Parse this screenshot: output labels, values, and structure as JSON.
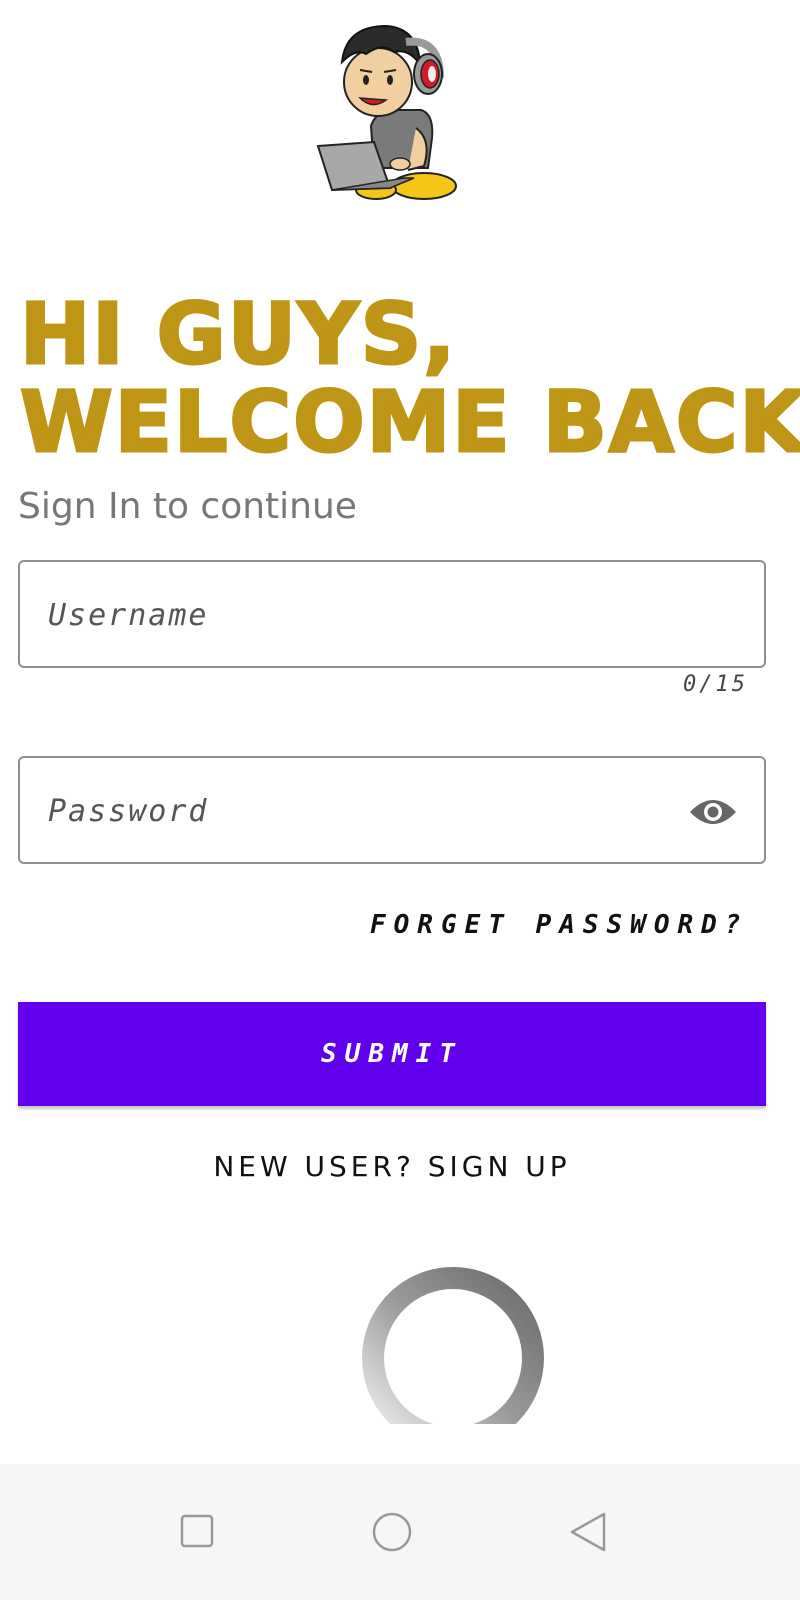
{
  "header": {
    "title_line1": "HI GUYS,",
    "title_line2": "WELCOME BACK",
    "subtitle": "Sign In to continue"
  },
  "logo": {
    "icon": "gamer-boy-laptop-illustration"
  },
  "form": {
    "username": {
      "value": "",
      "placeholder": "Username",
      "counter": "0/15"
    },
    "password": {
      "value": "",
      "placeholder": "Password",
      "toggle_icon": "eye-icon"
    },
    "forget_label": "FORGET PASSWORD?",
    "submit_label": "SUBMIT",
    "signup_label": "NEW USER? SIGN UP"
  },
  "loading": {
    "icon": "loading-spinner"
  },
  "navbar": {
    "items": [
      {
        "icon": "square-icon"
      },
      {
        "icon": "circle-icon"
      },
      {
        "icon": "triangle-back-icon"
      }
    ]
  },
  "colors": {
    "title": "#bf9515",
    "accent": "#6200ee",
    "subtitle": "#777777",
    "navbar_bg": "#f6f6f6"
  }
}
